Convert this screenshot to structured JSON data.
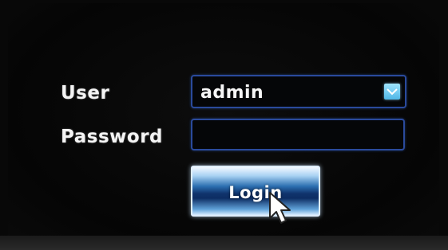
{
  "login_form": {
    "user_label": "User",
    "user_value": "admin",
    "password_label": "Password",
    "password_value": "",
    "login_label": "Login"
  },
  "icons": {
    "dropdown": "chevron-down-icon",
    "cursor": "mouse-pointer-icon"
  },
  "colors": {
    "background": "#080808",
    "field_border": "#2a4a9c",
    "dropdown_button": "#7cd0f3",
    "login_button": "#10346d"
  }
}
